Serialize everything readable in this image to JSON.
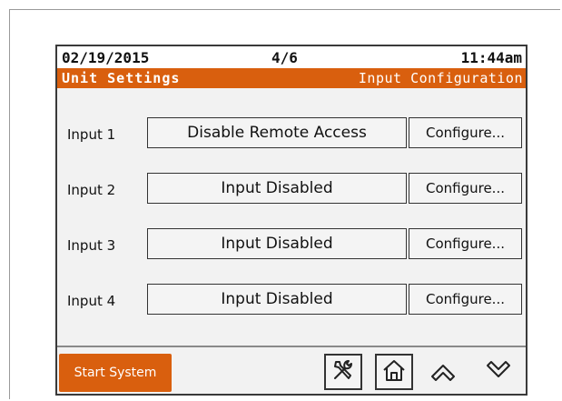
{
  "status": {
    "date": "02/19/2015",
    "page": "4/6",
    "time": "11:44am"
  },
  "titlebar": {
    "section": "Unit Settings",
    "page_title": "Input Configuration"
  },
  "inputs": [
    {
      "label": "Input 1",
      "value": "Disable Remote Access",
      "button": "Configure..."
    },
    {
      "label": "Input 2",
      "value": "Input Disabled",
      "button": "Configure..."
    },
    {
      "label": "Input 3",
      "value": "Input Disabled",
      "button": "Configure..."
    },
    {
      "label": "Input 4",
      "value": "Input Disabled",
      "button": "Configure..."
    }
  ],
  "footer": {
    "start_label": "Start System",
    "icons": [
      "tools-icon",
      "home-icon",
      "chevron-up-icon",
      "chevron-down-icon"
    ]
  },
  "colors": {
    "accent": "#d95f0e",
    "background": "#f2f2f2"
  }
}
